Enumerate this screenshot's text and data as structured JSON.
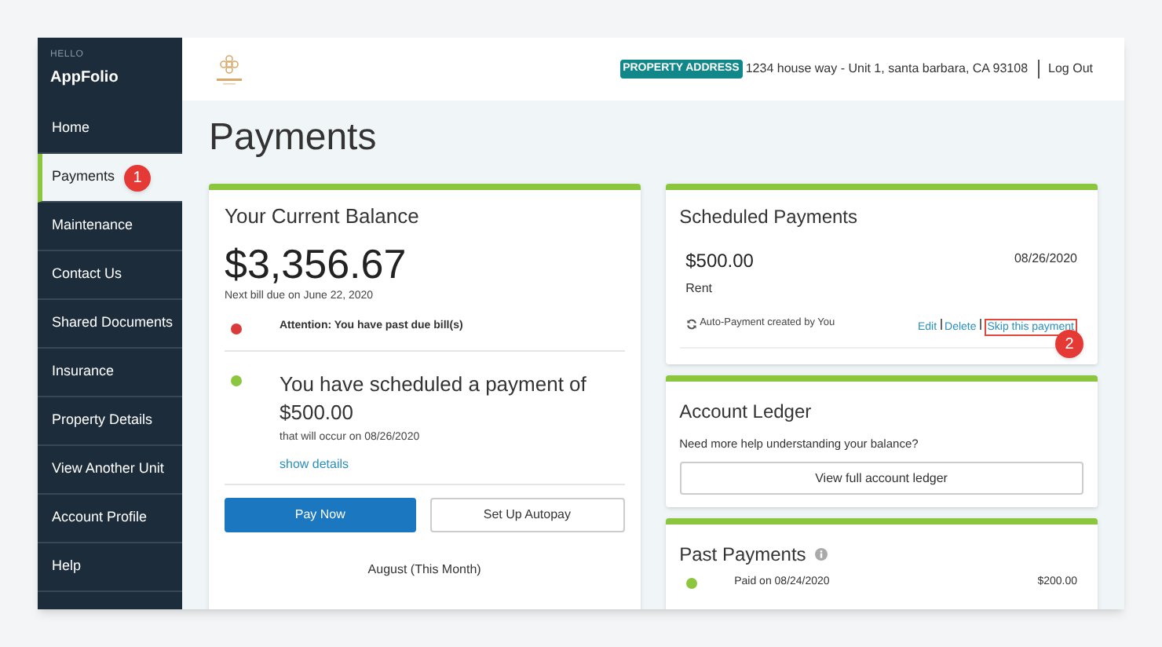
{
  "sidebar": {
    "greeting": "HELLO",
    "account": "AppFolio",
    "items": [
      {
        "label": "Home",
        "selected": false
      },
      {
        "label": "Payments",
        "selected": true,
        "badge": "1"
      },
      {
        "label": "Maintenance",
        "selected": false
      },
      {
        "label": "Contact Us",
        "selected": false
      },
      {
        "label": "Shared Documents",
        "selected": false
      },
      {
        "label": "Insurance",
        "selected": false
      },
      {
        "label": "Property Details",
        "selected": false
      },
      {
        "label": "View Another Unit",
        "selected": false
      },
      {
        "label": "Account Profile",
        "selected": false
      },
      {
        "label": "Help",
        "selected": false
      }
    ]
  },
  "header": {
    "address_label": "PROPERTY ADDRESS",
    "address": "1234 house way - Unit 1, santa barbara, CA 93108",
    "logout": "Log Out"
  },
  "page_title": "Payments",
  "balance_card": {
    "title": "Your Current Balance",
    "amount": "$3,356.67",
    "next_bill": "Next bill due on June 22, 2020",
    "alerts": [
      {
        "color": "#d93a3a",
        "text": "Attention: You have past due bill(s)"
      },
      {
        "color": "#8cc63f",
        "text": "You have scheduled a payment of $500.00",
        "subtext": "that will occur on 08/26/2020",
        "link": "show details"
      }
    ],
    "buttons": [
      {
        "label": "Pay Now",
        "kind": "primary"
      },
      {
        "label": "Set Up Autopay",
        "kind": "secondary"
      }
    ],
    "month_label": "August (This Month)"
  },
  "scheduled_card": {
    "title": "Scheduled Payments",
    "amount": "$500.00",
    "date": "08/26/2020",
    "type": "Rent",
    "note": "Auto-Payment created by You",
    "actions": [
      {
        "label": "Edit",
        "highlighted": false
      },
      {
        "label": "Delete",
        "highlighted": false
      },
      {
        "label": "Skip this payment",
        "highlighted": true,
        "badge": "2"
      }
    ]
  },
  "ledger_card": {
    "title": "Account Ledger",
    "text": "Need more help understanding your balance?",
    "button": "View full account ledger"
  },
  "past_card": {
    "title": "Past Payments",
    "rows": [
      {
        "color": "#8cc63f",
        "text": "Paid on 08/24/2020",
        "amount": "$200.00"
      }
    ]
  }
}
